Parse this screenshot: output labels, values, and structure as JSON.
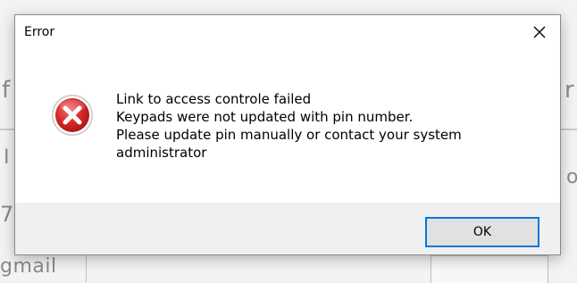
{
  "background": {
    "fragments": {
      "f1": "f",
      "f2": "I",
      "f3": "7",
      "f4": "gmail",
      "r1": "r",
      "r2": "o",
      "r3": ""
    }
  },
  "dialog": {
    "title": "Error",
    "close_icon": "close-icon",
    "error_icon": "error-icon",
    "message_lines": [
      "Link to access controle failed",
      "Keypads were not updated with pin number.",
      "Please update pin manually or contact your system",
      "administrator"
    ],
    "ok_label": "OK"
  },
  "colors": {
    "dialog_bg": "#ffffff",
    "footer_bg": "#f0f0f0",
    "button_border_focus": "#0078d7",
    "error_red": "#d92b2b"
  }
}
